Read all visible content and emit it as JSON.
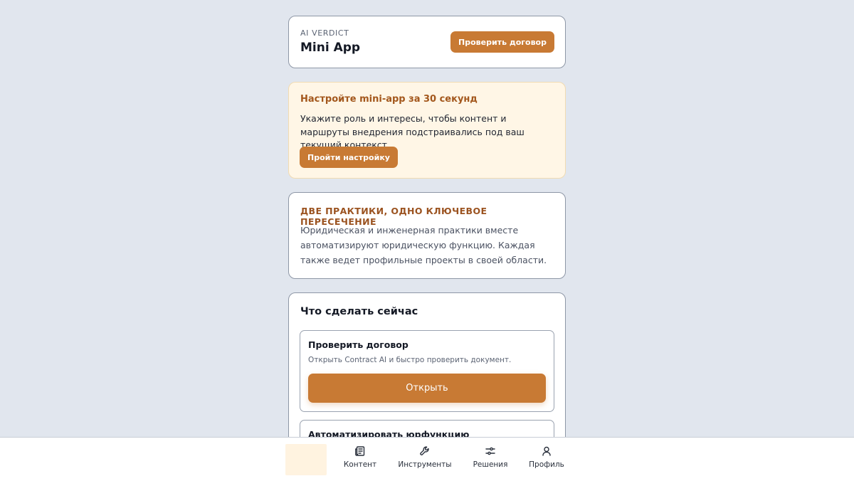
{
  "header": {
    "eyebrow": "AI VERDICT",
    "title": "Mini App",
    "check_button": "Проверить договор"
  },
  "setup": {
    "title": "Настройте mini-app за 30 секунд",
    "text": "Укажите роль и интересы, чтобы контент и маршруты внедрения подстраивались под ваш текущий контекст.",
    "button": "Пройти настройку"
  },
  "practices": {
    "title": "ДВЕ ПРАКТИКИ, ОДНО КЛЮЧЕВОЕ ПЕРЕСЕЧЕНИЕ",
    "text": "Юридическая и инженерная практики вместе автоматизируют юридическую функцию. Каждая также ведет профильные проекты в своей области."
  },
  "actions": {
    "title": "Что сделать сейчас",
    "items": [
      {
        "title": "Проверить договор",
        "description": "Открыть Contract AI и быстро проверить документ.",
        "button": "Открыть"
      },
      {
        "title": "Автоматизировать юрфункцию"
      }
    ]
  },
  "nav": {
    "items": [
      {
        "label": "Контент",
        "icon": "newspaper-icon"
      },
      {
        "label": "Инструменты",
        "icon": "wrench-icon"
      },
      {
        "label": "Решения",
        "icon": "sliders-icon"
      },
      {
        "label": "Профиль",
        "icon": "user-icon"
      }
    ]
  },
  "colors": {
    "accent": "#c87a34",
    "accent_text": "#a3571c",
    "setup_bg": "#fff6e6",
    "page_bg": "#e1e6ee"
  }
}
